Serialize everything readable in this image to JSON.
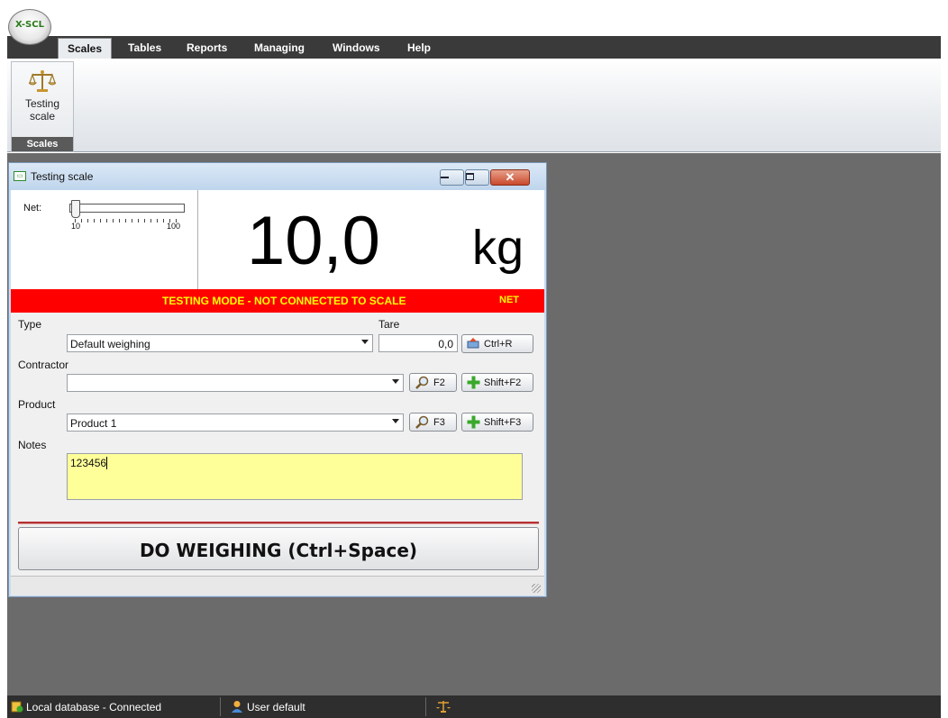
{
  "app": {
    "logo_text": "X-SCL"
  },
  "menu": {
    "items": [
      {
        "label": "Scales",
        "active": true
      },
      {
        "label": "Tables"
      },
      {
        "label": "Reports"
      },
      {
        "label": "Managing"
      },
      {
        "label": "Windows"
      },
      {
        "label": "Help"
      }
    ]
  },
  "ribbon": {
    "button_label_line1": "Testing",
    "button_label_line2": "scale",
    "group_label": "Scales",
    "button_icon": "scale-icon"
  },
  "window": {
    "title": "Testing scale",
    "display": {
      "net_label": "Net:",
      "slider_min": "10",
      "slider_max": "100",
      "slider_level": 0.0,
      "weight": "10,0",
      "unit": "kg"
    },
    "status": {
      "message": "TESTING MODE - NOT CONNECTED TO SCALE",
      "indicator": "NET",
      "color": "#ff0000",
      "text_color": "#ffff00"
    },
    "form": {
      "type_label": "Type",
      "type_value": "Default weighing",
      "tare_label": "Tare",
      "tare_value": "0,0",
      "tare_button": "Ctrl+R",
      "contractor_label": "Contractor",
      "contractor_value": "",
      "contractor_search": "F2",
      "contractor_add": "Shift+F2",
      "product_label": "Product",
      "product_value": "Product 1",
      "product_search": "F3",
      "product_add": "Shift+F3",
      "notes_label": "Notes",
      "notes_value": "123456",
      "notes_bg": "#ffff99"
    },
    "weigh_button": "DO WEIGHING (Ctrl+Space)"
  },
  "statusbar": {
    "database": "Local database - Connected",
    "user": "User default"
  }
}
